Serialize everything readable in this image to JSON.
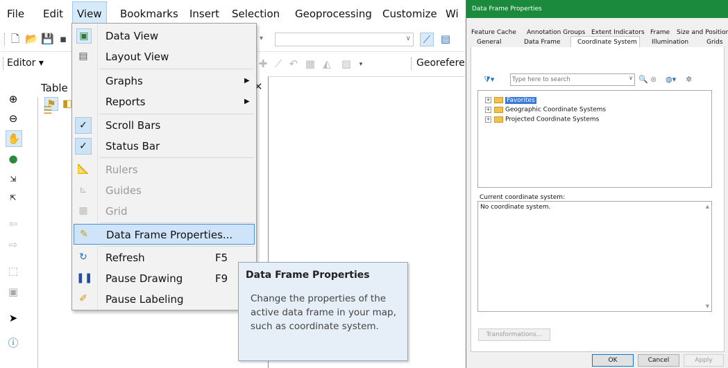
{
  "menubar": {
    "items": [
      "File",
      "Edit",
      "View",
      "Bookmarks",
      "Insert",
      "Selection",
      "Geoprocessing",
      "Customize",
      "Wi"
    ]
  },
  "toolbar": {
    "editor_label": "Editor",
    "georef_label": "Georefere"
  },
  "toc": {
    "title": "Table C"
  },
  "view_menu": {
    "items": [
      {
        "label": "Data View",
        "icon": "data-view-icon"
      },
      {
        "label": "Layout View",
        "icon": "layout-view-icon"
      },
      {
        "label": "Graphs",
        "submenu": true
      },
      {
        "label": "Reports",
        "submenu": true
      },
      {
        "label": "Scroll Bars",
        "checked": true
      },
      {
        "label": "Status Bar",
        "checked": true
      },
      {
        "label": "Rulers",
        "disabled": true
      },
      {
        "label": "Guides",
        "disabled": true
      },
      {
        "label": "Grid",
        "disabled": true
      },
      {
        "label": "Data Frame Properties...",
        "highlighted": true
      },
      {
        "label": "Refresh",
        "shortcut": "F5"
      },
      {
        "label": "Pause Drawing",
        "shortcut": "F9"
      },
      {
        "label": "Pause Labeling"
      }
    ]
  },
  "tooltip": {
    "title": "Data Frame Properties",
    "text": "Change the properties of the active data frame in your map, such as coordinate system."
  },
  "dialog": {
    "title": "Data Frame Properties",
    "tabs_row1": [
      "Feature Cache",
      "Annotation Groups",
      "Extent Indicators",
      "Frame",
      "Size and Position"
    ],
    "tabs_row2": [
      "General",
      "Data Frame",
      "Coordinate System",
      "Illumination",
      "Grids"
    ],
    "active_tab": "Coordinate System",
    "search_placeholder": "Type here to search",
    "tree": [
      "Favorites",
      "Geographic Coordinate Systems",
      "Projected Coordinate Systems"
    ],
    "current_cs_label": "Current coordinate system:",
    "current_cs_value": "No coordinate system.",
    "transformations_button": "Transformations...",
    "ok": "OK",
    "cancel": "Cancel",
    "apply": "Apply"
  },
  "colors": {
    "dialog_titlebar": "#1c8a3c",
    "menu_highlight": "#cfe4f8",
    "selection": "#3b78d8"
  }
}
